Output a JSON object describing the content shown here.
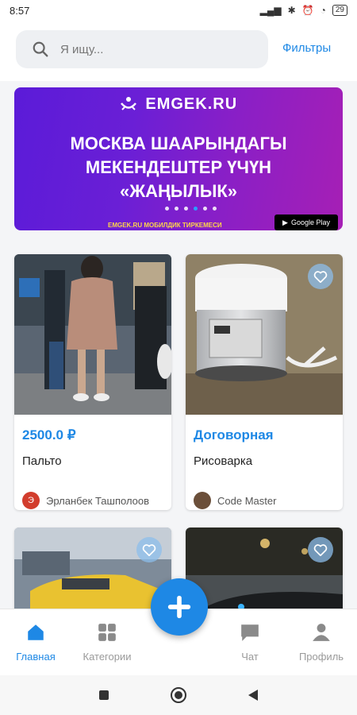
{
  "status_bar": {
    "time": "8:57",
    "battery": "29"
  },
  "search": {
    "placeholder": "Я ищу...",
    "filters_label": "Фильтры"
  },
  "banner": {
    "logo_text": "EMGEK.RU",
    "headline": [
      "МОСКВА ШААРЫНДАГЫ",
      "МЕКЕНДЕШТЕР ҮЧҮН",
      "«ЖАҢЫЛЫК»"
    ],
    "subline": "EMGEK.RU МОБИЛДИК ТИРКЕМЕСИ",
    "store_badge": "Google Play",
    "slides_total": 6,
    "active_slide": 4
  },
  "listings": [
    {
      "price": "2500.0 ₽",
      "title": "Пальто",
      "seller": "Эрланбек Ташполоов",
      "seller_initial": "Э"
    },
    {
      "price": "Договорная",
      "title": "Рисоварка",
      "seller": "Code Master"
    }
  ],
  "bottom_nav": {
    "items": [
      {
        "label": "Главная",
        "icon": "home-icon"
      },
      {
        "label": "Категории",
        "icon": "grid-icon"
      },
      {
        "label": "Чат",
        "icon": "chat-icon"
      },
      {
        "label": "Профиль",
        "icon": "person-icon"
      }
    ],
    "fab_icon": "plus-icon"
  },
  "colors": {
    "accent": "#1e88e5",
    "banner_start": "#5b1bd8",
    "banner_end": "#a61fb5"
  }
}
